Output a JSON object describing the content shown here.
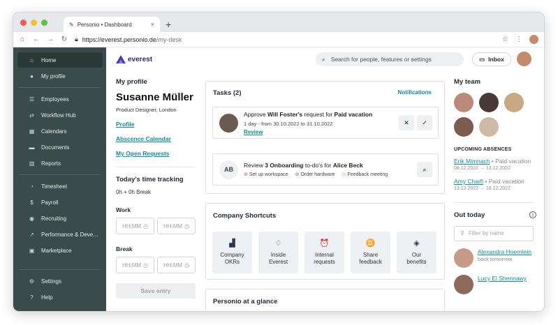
{
  "browser": {
    "tab_title": "Personio • Dashboard",
    "tab_close": "×",
    "new_tab": "+",
    "url_host": "https://everest.personio.de",
    "url_path": "/my-desk"
  },
  "sidebar": {
    "items": [
      {
        "label": "Home",
        "icon": "home-icon",
        "glyph": "⌂"
      },
      {
        "label": "My profile",
        "icon": "person-icon",
        "glyph": "●"
      },
      {
        "label": "Employees",
        "icon": "people-icon",
        "glyph": "☰"
      },
      {
        "label": "Workflow Hub",
        "icon": "workflow-icon",
        "glyph": "⇄"
      },
      {
        "label": "Calendars",
        "icon": "calendar-icon",
        "glyph": "▦"
      },
      {
        "label": "Documents",
        "icon": "folder-icon",
        "glyph": "▬"
      },
      {
        "label": "Reports",
        "icon": "chart-icon",
        "glyph": "▥"
      },
      {
        "label": "Timesheet",
        "icon": "clock-icon",
        "glyph": "◔"
      },
      {
        "label": "Payroll",
        "icon": "dollar-icon",
        "glyph": "$"
      },
      {
        "label": "Recruiting",
        "icon": "recruiting-icon",
        "glyph": "◉"
      },
      {
        "label": "Performance & Deve…",
        "icon": "performance-icon",
        "glyph": "↗"
      },
      {
        "label": "Marketplace",
        "icon": "marketplace-icon",
        "glyph": "▣"
      },
      {
        "label": "Settings",
        "icon": "gear-icon",
        "glyph": "⚙"
      },
      {
        "label": "Help",
        "icon": "help-icon",
        "glyph": "?"
      }
    ]
  },
  "topbar": {
    "logo_text": "everest",
    "search_placeholder": "Search for people, features or settings",
    "inbox_label": "Inbox"
  },
  "profile": {
    "heading": "My profile",
    "name": "Susanne Müller",
    "role": "Product Designer, London",
    "links": [
      "Profile",
      "Abscence Calendar",
      "My Open Requests"
    ]
  },
  "time_tracking": {
    "heading": "Today's time tracking",
    "summary": "0h + 0h Break",
    "work_label": "Work",
    "break_label": "Break",
    "placeholder": "HH:MM",
    "save_label": "Save entry"
  },
  "tasks": {
    "heading": "Tasks (2)",
    "notifications_link": "Notifications",
    "task1": {
      "prefix": "Approve ",
      "person": "Will Foster's",
      "mid": " request for ",
      "type": "Paid vacation",
      "detail": "1 day - from 30.10.2022 to 31.10.2022",
      "review": "Review"
    },
    "task2": {
      "initials": "AB",
      "prefix": "Review ",
      "count": "3 Onboarding",
      "mid": " to-do's for ",
      "person": "Alice Beck",
      "chips": [
        "Set up workspace",
        "Order hardware",
        "Feedback meeting"
      ]
    }
  },
  "shortcuts": {
    "heading": "Company Shortcuts",
    "items": [
      {
        "label1": "Company",
        "label2": "OKRs",
        "glyph": "▟"
      },
      {
        "label1": "Inside",
        "label2": "Everest",
        "glyph": "♢"
      },
      {
        "label1": "Internal",
        "label2": "requests",
        "glyph": "⏰"
      },
      {
        "label1": "Share",
        "label2": "feedback",
        "glyph": "♊"
      },
      {
        "label1": "Our",
        "label2": "benefits",
        "glyph": "◈"
      }
    ]
  },
  "glance": {
    "heading": "Personio at a glance"
  },
  "team": {
    "heading": "My team",
    "upcoming_heading": "UPCOMING ABSENCES",
    "absences": [
      {
        "name": "Erik Mimnach",
        "type": " • Paid vacation",
        "dates": "08.12.2022 → 13.12.2022"
      },
      {
        "name": "Amy Charfi",
        "type": " • Paid vacation",
        "dates": "13.12.2022 → 16.12.2022"
      }
    ]
  },
  "out_today": {
    "heading": "Out today",
    "filter_placeholder": "Filter by name",
    "people": [
      {
        "name": "Alexandra Hoernlein",
        "status": "back tomorrow"
      },
      {
        "name": "Lucy El Shennawy",
        "status": ""
      }
    ]
  },
  "colors": {
    "sidebar_bg": "#3a4b4b",
    "accent_link": "#0e8ca0",
    "logo_purple": "#4b3fa8"
  }
}
